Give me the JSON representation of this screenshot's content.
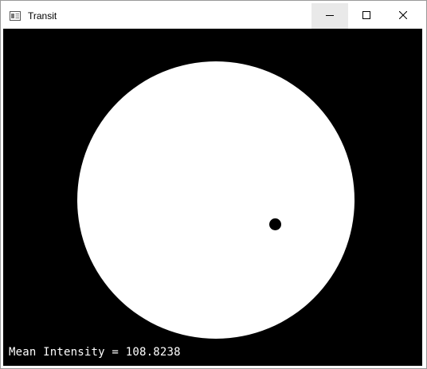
{
  "window": {
    "title": "Transit",
    "app_icon": "window-app-icon",
    "controls": {
      "minimize_icon": "minimize-icon",
      "maximize_icon": "maximize-icon",
      "close_icon": "close-icon"
    }
  },
  "canvas": {
    "background_color": "#000000",
    "star_color": "#ffffff",
    "planet_color": "#000000",
    "overlay_text": "Mean Intensity = 108.8238"
  }
}
